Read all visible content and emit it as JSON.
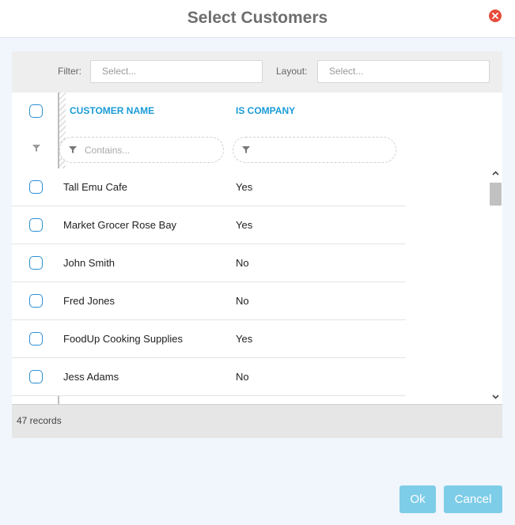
{
  "dialog": {
    "title": "Select Customers"
  },
  "toolbar": {
    "filter_label": "Filter:",
    "filter_placeholder": "Select...",
    "layout_label": "Layout:",
    "layout_placeholder": "Select..."
  },
  "grid": {
    "columns": [
      "CUSTOMER NAME",
      "IS COMPANY"
    ],
    "name_filter_placeholder": "Contains...",
    "rows": [
      {
        "name": "Tall Emu Cafe",
        "is_company": "Yes"
      },
      {
        "name": "Market Grocer Rose Bay",
        "is_company": "Yes"
      },
      {
        "name": "John Smith",
        "is_company": "No"
      },
      {
        "name": "Fred Jones",
        "is_company": "No"
      },
      {
        "name": "FoodUp Cooking Supplies",
        "is_company": "Yes"
      },
      {
        "name": "Jess Adams",
        "is_company": "No"
      }
    ],
    "record_count": "47 records"
  },
  "buttons": {
    "ok": "Ok",
    "cancel": "Cancel"
  },
  "colors": {
    "accent": "#1a9bd7",
    "button": "#7ecde8",
    "close": "#e74c3c"
  },
  "icons": [
    "close-icon",
    "filter-icon",
    "chevron-up-icon",
    "chevron-down-icon"
  ]
}
